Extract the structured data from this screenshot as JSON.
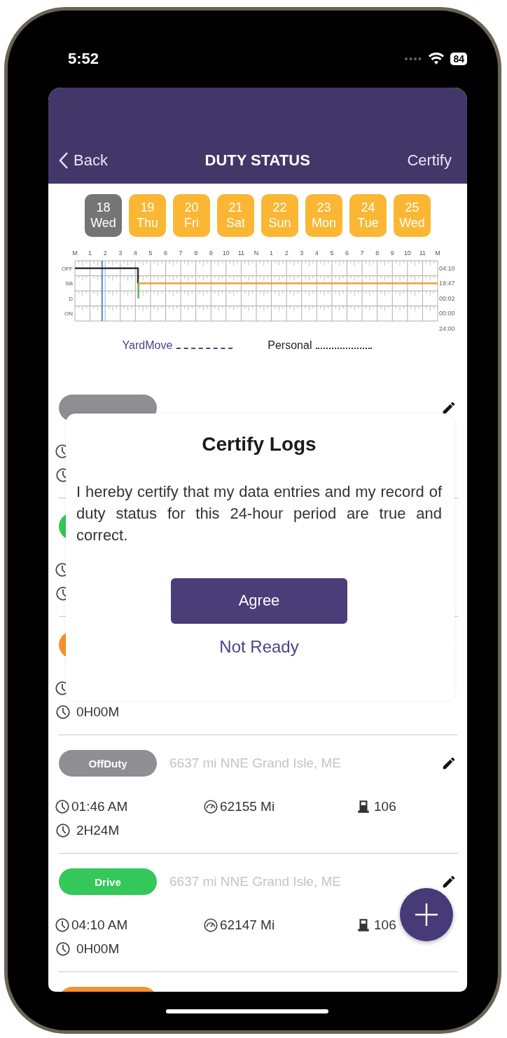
{
  "status_bar": {
    "time": "5:52",
    "battery": "84"
  },
  "header": {
    "back": "Back",
    "title": "DUTY STATUS",
    "action": "Certify"
  },
  "days": [
    {
      "day": "18",
      "weekday": "Wed",
      "selected": true
    },
    {
      "day": "19",
      "weekday": "Thu",
      "selected": false
    },
    {
      "day": "20",
      "weekday": "Fri",
      "selected": false
    },
    {
      "day": "21",
      "weekday": "Sat",
      "selected": false
    },
    {
      "day": "22",
      "weekday": "Sun",
      "selected": false
    },
    {
      "day": "23",
      "weekday": "Mon",
      "selected": false
    },
    {
      "day": "24",
      "weekday": "Tue",
      "selected": false
    },
    {
      "day": "25",
      "weekday": "Wed",
      "selected": false
    }
  ],
  "log_graph": {
    "hour_labels": [
      "M",
      "1",
      "2",
      "3",
      "4",
      "5",
      "6",
      "7",
      "8",
      "9",
      "10",
      "11",
      "N",
      "1",
      "2",
      "3",
      "4",
      "5",
      "6",
      "7",
      "8",
      "9",
      "10",
      "11",
      "M"
    ],
    "status_labels": [
      "OFF",
      "SB",
      "D",
      "ON"
    ],
    "row_totals": [
      "04:10",
      "19:47",
      "00:02",
      "00:00"
    ],
    "total": "24:00"
  },
  "legend": [
    {
      "label": "YardMove",
      "kind": "dashed"
    },
    {
      "label": "Personal",
      "kind": "dotted"
    }
  ],
  "logs": [
    {
      "color": "#8e8e93"
    },
    {
      "color": "#34c759"
    },
    {
      "color": "#f5922f",
      "duration": "0H00M"
    },
    {
      "color": "#8e8e93",
      "label": "OffDuty",
      "location": "6637 mi NNE Grand Isle, ME",
      "time": "01:46 AM",
      "odometer": "62155 Mi",
      "unit": "106",
      "duration": "2H24M"
    },
    {
      "color": "#34c759",
      "label": "Drive",
      "location": "6637 mi NNE Grand Isle, ME",
      "time": "04:10 AM",
      "odometer": "62147 Mi",
      "unit": "106",
      "duration": "0H00M"
    },
    {
      "color": "#f5922f"
    }
  ],
  "dialog": {
    "title": "Certify Logs",
    "message": "I hereby certify that my data entries and my record of duty status for this 24-hour period are true and correct.",
    "primary": "Agree",
    "secondary": "Not Ready"
  }
}
